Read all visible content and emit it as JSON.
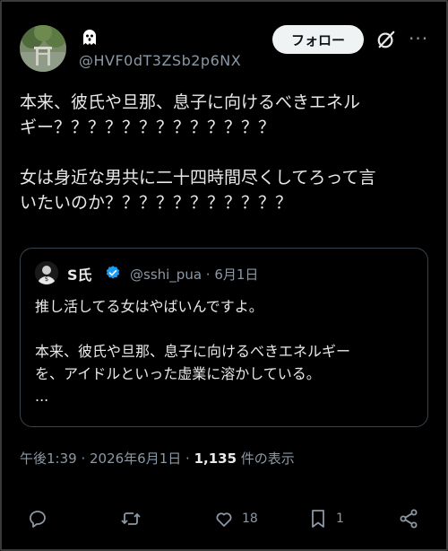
{
  "author": {
    "handle": "@HVF0dT3ZSb2p6NX",
    "name_icon": "ghost-icon"
  },
  "header": {
    "follow_label": "フォロー",
    "grok_icon": "grok-icon",
    "more_icon": "more-icon"
  },
  "tweet": {
    "lines": [
      "本来、彼氏や旦那、息子に向けるべきエネル",
      "ギー？？？？？？？？？？？？？",
      "女は身近な男共に二十四時間尽くしてろって言",
      "いたいのか？？？？？？？？？？？"
    ]
  },
  "quote": {
    "name": "S氏",
    "handle_date": "@sshi_pua · 6月1日",
    "line1": "推し活してる女はやばいんですよ。",
    "line2": "本来、彼氏や旦那、息子に向けるべきエネルギー",
    "line3": "を、アイドルといった虚業に溶かしている。",
    "line4": "..."
  },
  "meta": {
    "time": "午後1:39 · 2026年6月1日 · ",
    "views": "1,135",
    "views_label": " 件の表示"
  },
  "actions": {
    "reply_icon": "reply-icon",
    "retweet_icon": "retweet-icon",
    "like_icon": "heart-icon",
    "like_count": "18",
    "bookmark_icon": "bookmark-icon",
    "bookmark_count": "1",
    "share_icon": "share-icon"
  },
  "colors": {
    "background": "#000000",
    "text": "#e7e9ea",
    "secondary": "#8b98a5",
    "verified": "#1d9bf0",
    "border": "#38444d"
  }
}
